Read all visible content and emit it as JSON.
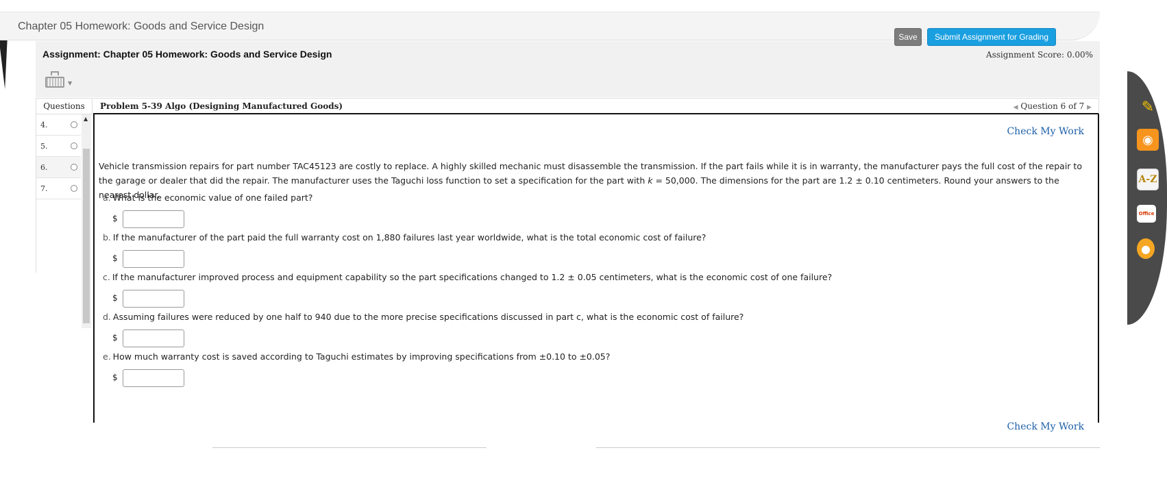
{
  "page": {
    "chapter_title": "Chapter 05 Homework: Goods and Service Design"
  },
  "assignment": {
    "title": "Assignment: Chapter 05 Homework: Goods and Service Design",
    "score": "Assignment Score: 0.00%",
    "save_label": "Save",
    "submit_label": "Submit Assignment for Grading"
  },
  "questions_panel": {
    "header": "Questions",
    "items": [
      {
        "number": "4."
      },
      {
        "number": "5."
      },
      {
        "number": "6."
      },
      {
        "number": "7."
      }
    ]
  },
  "problem": {
    "title": "Problem 5-39 Algo (Designing Manufactured Goods)",
    "nav": "Question 6 of 7",
    "check_label": "Check My Work",
    "intro_1": "Vehicle transmission repairs for part number TAC45123 are costly to replace. A highly skilled mechanic must disassemble the transmission. If the part fails while it is in warranty, the manufacturer pays the full cost of the repair to the garage or dealer that did the repair. The manufacturer uses the Taguchi loss function to set a specification for the part with ",
    "intro_k": "k",
    "intro_2": " = 50,000. The dimensions for the part are 1.2 ± 0.10 centimeters. Round your answers to the nearest dollar.",
    "parts": [
      {
        "letter": "a.",
        "text": "What is the economic value of one failed part?"
      },
      {
        "letter": "b.",
        "text": "If the manufacturer of the part paid the full warranty cost on 1,880 failures last year worldwide, what is the total economic cost of failure?"
      },
      {
        "letter": "c.",
        "text": "If the manufacturer improved process and equipment capability so the part specifications changed to 1.2 ± 0.05 centimeters, what is the economic cost of one failure?"
      },
      {
        "letter": "d.",
        "text": "Assuming failures were reduced by one half to 940 due to the more precise specifications discussed in part c, what is the economic cost of failure?"
      },
      {
        "letter": "e.",
        "text": "How much warranty cost is saved according to Taguchi estimates by improving specifications from ±0.10 to ±0.05?"
      }
    ],
    "currency_symbol": "$"
  },
  "sidebar_icons": {
    "az_label": "A-Z",
    "office_label": "Office"
  },
  "colors": {
    "submit_button": "#1a9fe0",
    "save_button": "#7c7c7c",
    "link": "#1d5fa8"
  }
}
